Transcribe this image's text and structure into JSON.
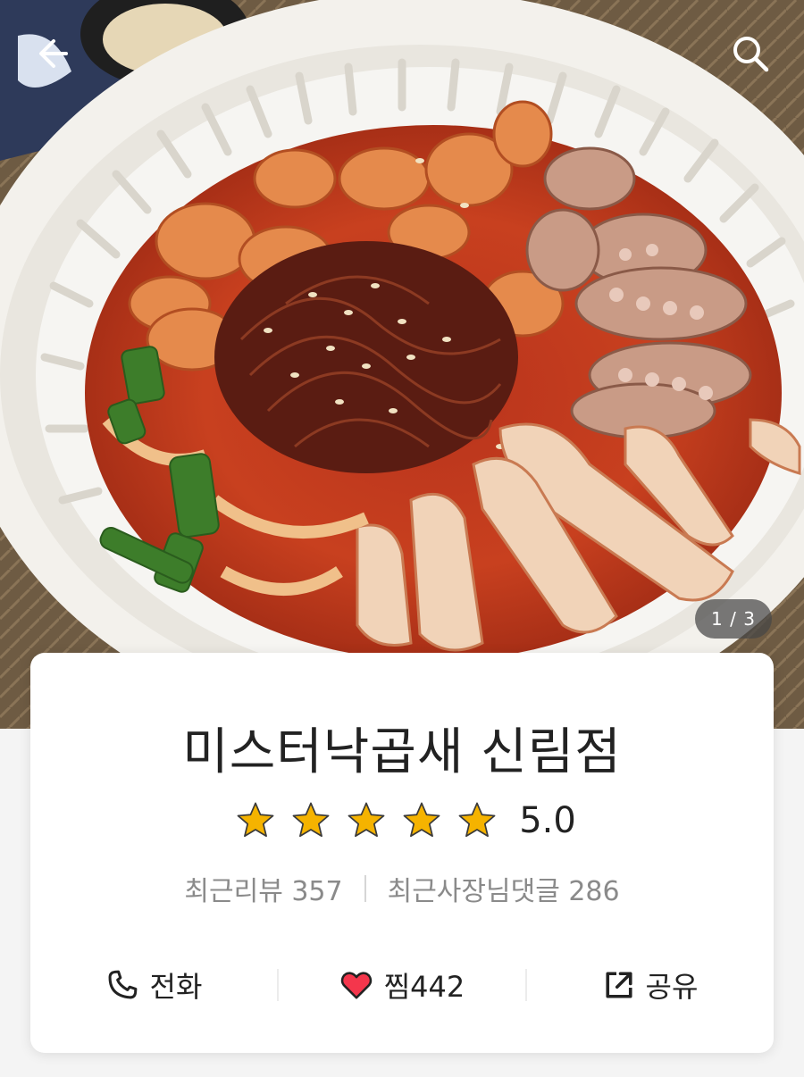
{
  "header": {
    "back_icon": "arrow-left-icon",
    "search_icon": "search-icon"
  },
  "photo": {
    "counter": "1 / 3"
  },
  "store": {
    "name": "미스터낙곱새 신림점",
    "rating": "5.0",
    "star_count": 5,
    "star_color": "#f5b300",
    "recent_reviews": "최근리뷰 357",
    "recent_owner_comments": "최근사장님댓글 286"
  },
  "actions": {
    "call_label": "전화",
    "call_icon": "phone-icon",
    "like_label": "찜442",
    "like_icon": "heart-icon",
    "like_color": "#f4364c",
    "share_label": "공유",
    "share_icon": "share-icon"
  }
}
